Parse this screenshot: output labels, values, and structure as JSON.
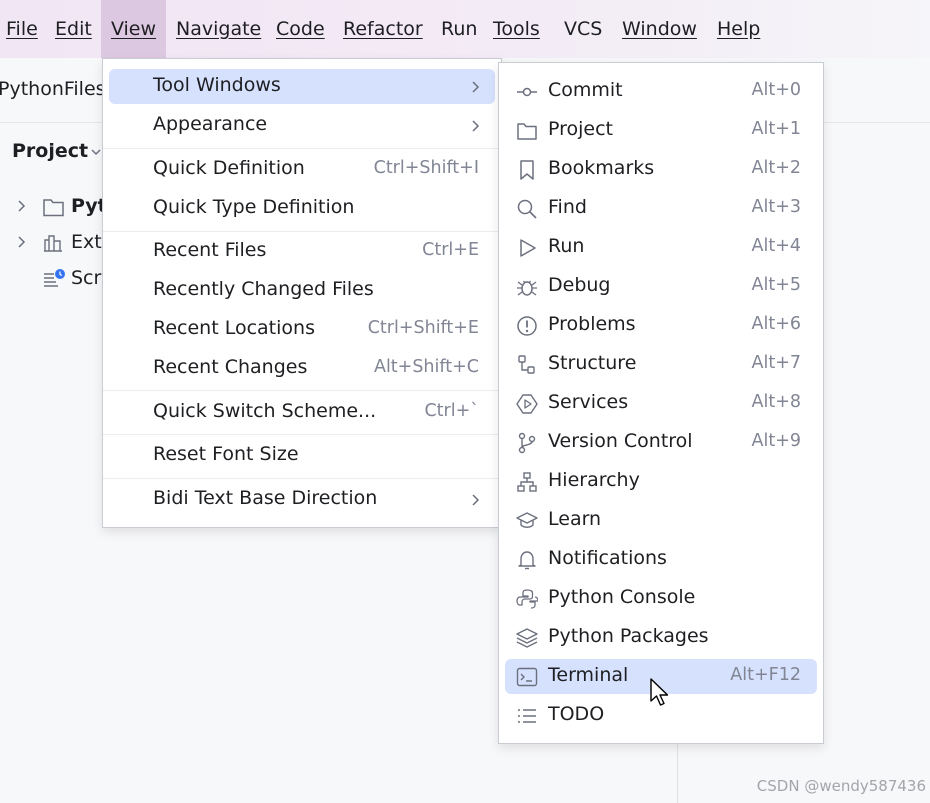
{
  "menubar": {
    "file": "File",
    "edit": "Edit",
    "view": "View",
    "navigate": "Navigate",
    "code": "Code",
    "refactor": "Refactor",
    "run": "Run",
    "tools": "Tools",
    "vcs": "VCS",
    "window": "Window",
    "help": "Help"
  },
  "background": {
    "breadcrumb": "PythonFiles",
    "project_title": "Project",
    "tree": [
      "Pyt",
      "Ext",
      "Scr"
    ]
  },
  "view_menu": {
    "items": [
      {
        "label": "Tool Windows",
        "shortcut": ""
      },
      {
        "label": "Appearance",
        "shortcut": ""
      },
      {
        "label": "Quick Definition",
        "shortcut": "Ctrl+Shift+I"
      },
      {
        "label": "Quick Type Definition",
        "shortcut": ""
      },
      {
        "label": "Recent Files",
        "shortcut": "Ctrl+E"
      },
      {
        "label": "Recently Changed Files",
        "shortcut": ""
      },
      {
        "label": "Recent Locations",
        "shortcut": "Ctrl+Shift+E"
      },
      {
        "label": "Recent Changes",
        "shortcut": "Alt+Shift+C"
      },
      {
        "label": "Quick Switch Scheme...",
        "shortcut": "Ctrl+`"
      },
      {
        "label": "Reset Font Size",
        "shortcut": ""
      },
      {
        "label": "Bidi Text Base Direction",
        "shortcut": ""
      }
    ]
  },
  "tool_windows_menu": {
    "items": [
      {
        "label": "Commit",
        "shortcut": "Alt+0",
        "icon": "commit-icon"
      },
      {
        "label": "Project",
        "shortcut": "Alt+1",
        "icon": "folder-icon"
      },
      {
        "label": "Bookmarks",
        "shortcut": "Alt+2",
        "icon": "bookmark-icon"
      },
      {
        "label": "Find",
        "shortcut": "Alt+3",
        "icon": "search-icon"
      },
      {
        "label": "Run",
        "shortcut": "Alt+4",
        "icon": "run-icon"
      },
      {
        "label": "Debug",
        "shortcut": "Alt+5",
        "icon": "bug-icon"
      },
      {
        "label": "Problems",
        "shortcut": "Alt+6",
        "icon": "warning-icon"
      },
      {
        "label": "Structure",
        "shortcut": "Alt+7",
        "icon": "structure-icon"
      },
      {
        "label": "Services",
        "shortcut": "Alt+8",
        "icon": "services-icon"
      },
      {
        "label": "Version Control",
        "shortcut": "Alt+9",
        "icon": "branch-icon"
      },
      {
        "label": "Hierarchy",
        "shortcut": "",
        "icon": "hierarchy-icon"
      },
      {
        "label": "Learn",
        "shortcut": "",
        "icon": "graduation-cap-icon"
      },
      {
        "label": "Notifications",
        "shortcut": "",
        "icon": "bell-icon"
      },
      {
        "label": "Python Console",
        "shortcut": "",
        "icon": "python-icon"
      },
      {
        "label": "Python Packages",
        "shortcut": "",
        "icon": "layers-icon"
      },
      {
        "label": "Terminal",
        "shortcut": "Alt+F12",
        "icon": "terminal-icon"
      },
      {
        "label": "TODO",
        "shortcut": "",
        "icon": "list-icon"
      }
    ],
    "highlighted": "Terminal"
  },
  "watermark": "CSDN @wendy587436",
  "colors": {
    "menubar_bg": "#f1e6f4",
    "active_menu_bg": "#ddc8e1",
    "highlight_bg": "#d5e1fd",
    "shortcut_text": "#818594"
  }
}
